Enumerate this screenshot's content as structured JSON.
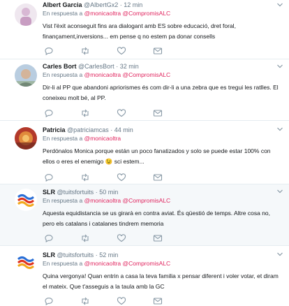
{
  "reply_prefix": "En respuesta a",
  "tweets": [
    {
      "name": "Albert Garcia",
      "handle": "@AlbertGx2",
      "time": "12 min",
      "mentions": "@monicaoltra @CompromisALC",
      "text": "Vist l'èxit aconseguit fins ara dialogant amb ES sobre educació, dret foral, finançament,inversions... em pense q no estem pa donar consells",
      "avatar": "avatar-albert"
    },
    {
      "name": "Carles Bort",
      "handle": "@CarlesBort",
      "time": "32 min",
      "mentions": "@monicaoltra @CompromisALC",
      "text": "Dir-li al PP que abandoni apriorismes és com dir-li a una zebra que es tregui les ratlles. El coneixeu molt bé, al PP.",
      "avatar": "avatar-carles"
    },
    {
      "name": "Patricia",
      "handle": "@patriciamcas",
      "time": "44 min",
      "mentions": "@monicaoltra",
      "text": "Perdónalos Monica porque están un poco fanatizados y solo se puede estar 100% con ellos o eres el enemigo 😉 sci estem...",
      "avatar": "avatar-patricia"
    },
    {
      "name": "SLR",
      "handle": "@tuitsfortuits",
      "time": "50 min",
      "mentions": "@monicaoltra @CompromisALC",
      "text": "Aquesta equidistancia se us girarà en contra aviat. És qüestió de temps. Altre cosa no, pero els catalans i catalanes tindrem memoria",
      "avatar": "avatar-slr"
    },
    {
      "name": "SLR",
      "handle": "@tuitsfortuits",
      "time": "52 min",
      "mentions": "@monicaoltra @CompromisALC",
      "text": "Quina vergonya! Quan entrin a casa la teva familia x pensar diferent i voler votar, et diram el mateix. Que t'asseguis a la taula amb la GC",
      "avatar": "avatar-slr"
    }
  ],
  "icons": {
    "reply": "reply-icon",
    "retweet": "retweet-icon",
    "like": "like-icon",
    "message": "message-icon",
    "more": "chevron-down-icon"
  },
  "colors": {
    "mention": "#e0245e",
    "meta": "#657786",
    "highlight": "#f5f8fa",
    "border": "#e6ecf0"
  }
}
